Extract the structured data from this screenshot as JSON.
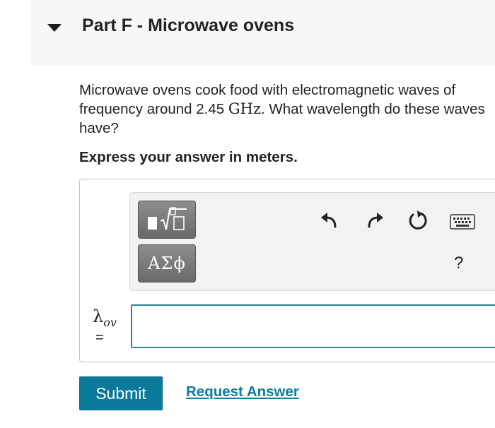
{
  "part": {
    "title": "Part F - Microwave ovens"
  },
  "question": {
    "text_before": "Microwave ovens cook food with electromagnetic waves of frequency around 2.45 ",
    "unit": "GHz",
    "text_after": ". What wavelength do these waves have?",
    "instruction": "Express your answer in meters."
  },
  "toolbar": {
    "templates_icon": "templates-icon",
    "symbols_label": "ΑΣϕ",
    "undo_icon": "undo-icon",
    "redo_icon": "redo-icon",
    "reset_icon": "reset-icon",
    "keyboard_icon": "keyboard-icon",
    "help_label": "?"
  },
  "answer": {
    "variable": "λ",
    "subscript": "ov",
    "equals": "=",
    "value": ""
  },
  "actions": {
    "submit_label": "Submit",
    "request_label": "Request Answer"
  },
  "colors": {
    "submit_bg": "#0b7a9a",
    "link": "#127b9a",
    "input_border": "#2a8591"
  }
}
